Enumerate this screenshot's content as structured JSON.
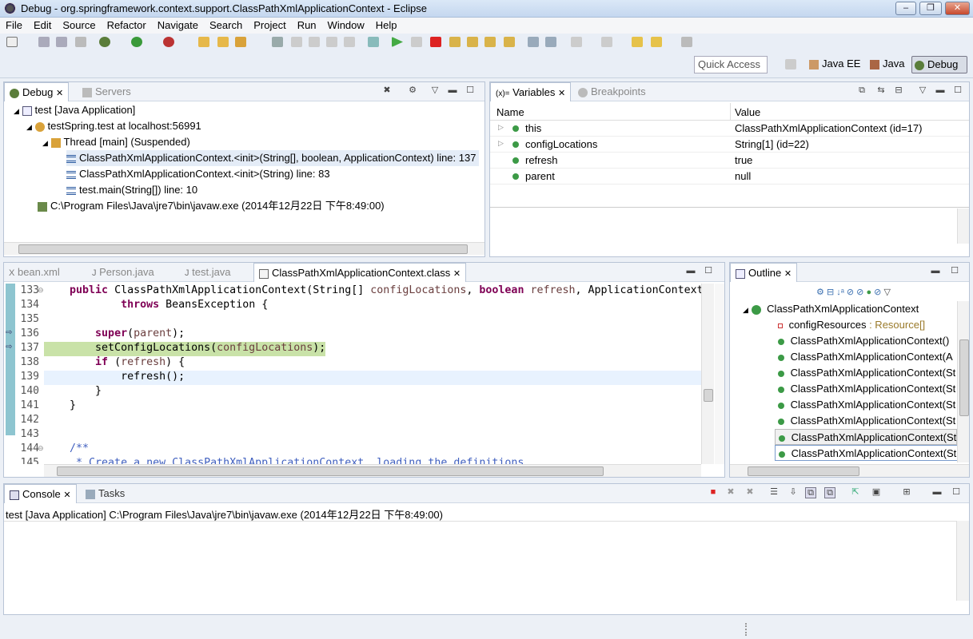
{
  "window": {
    "title": "Debug - org.springframework.context.support.ClassPathXmlApplicationContext - Eclipse"
  },
  "menu": [
    "File",
    "Edit",
    "Source",
    "Refactor",
    "Navigate",
    "Search",
    "Project",
    "Run",
    "Window",
    "Help"
  ],
  "quick_access": {
    "placeholder": "Quick Access"
  },
  "perspectives": {
    "java_ee": "Java EE",
    "java": "Java",
    "debug": "Debug"
  },
  "debug_view": {
    "tab": "Debug",
    "tab2": "Servers",
    "tree": [
      "test [Java Application]",
      "testSpring.test at localhost:56991",
      "Thread [main] (Suspended)",
      "ClassPathXmlApplicationContext.<init>(String[], boolean, ApplicationContext) line: 137",
      "ClassPathXmlApplicationContext.<init>(String) line: 83",
      "test.main(String[]) line: 10",
      "C:\\Program Files\\Java\\jre7\\bin\\javaw.exe (2014年12月22日 下午8:49:00)"
    ]
  },
  "variables_view": {
    "tab": "Variables",
    "tab2": "Breakpoints",
    "col_name": "Name",
    "col_value": "Value",
    "rows": [
      {
        "name": "this",
        "value": "ClassPathXmlApplicationContext  (id=17)"
      },
      {
        "name": "configLocations",
        "value": "String[1]  (id=22)"
      },
      {
        "name": "refresh",
        "value": "true"
      },
      {
        "name": "parent",
        "value": "null"
      }
    ]
  },
  "editor": {
    "tabs": [
      "bean.xml",
      "Person.java",
      "test.java",
      "ClassPathXmlApplicationContext.class"
    ],
    "lines": [
      {
        "n": "133",
        "t": "    public ClassPathXmlApplicationContext(String[] configLocations, boolean refresh, ApplicationContext"
      },
      {
        "n": "134",
        "t": "            throws BeansException {"
      },
      {
        "n": "135",
        "t": ""
      },
      {
        "n": "136",
        "t": "        super(parent);"
      },
      {
        "n": "137",
        "t": "        setConfigLocations(configLocations);"
      },
      {
        "n": "138",
        "t": "        if (refresh) {"
      },
      {
        "n": "139",
        "t": "            refresh();"
      },
      {
        "n": "140",
        "t": "        }"
      },
      {
        "n": "141",
        "t": "    }"
      },
      {
        "n": "142",
        "t": ""
      },
      {
        "n": "143",
        "t": ""
      },
      {
        "n": "144",
        "t": "    /**"
      },
      {
        "n": "145",
        "t": "     * Create a new ClassPathXmlApplicationContext, loading the definitions"
      }
    ]
  },
  "outline": {
    "tab": "Outline",
    "items": [
      "ClassPathXmlApplicationContext",
      "configResources",
      ": Resource[]",
      "ClassPathXmlApplicationContext()",
      "ClassPathXmlApplicationContext(A",
      "ClassPathXmlApplicationContext(St",
      "ClassPathXmlApplicationContext(St",
      "ClassPathXmlApplicationContext(St",
      "ClassPathXmlApplicationContext(St",
      "ClassPathXmlApplicationContext(St",
      "ClassPathXmlApplicationContext(String"
    ]
  },
  "console": {
    "tab": "Console",
    "tab2": "Tasks",
    "line": "test [Java Application] C:\\Program Files\\Java\\jre7\\bin\\javaw.exe (2014年12月22日 下午8:49:00)"
  }
}
